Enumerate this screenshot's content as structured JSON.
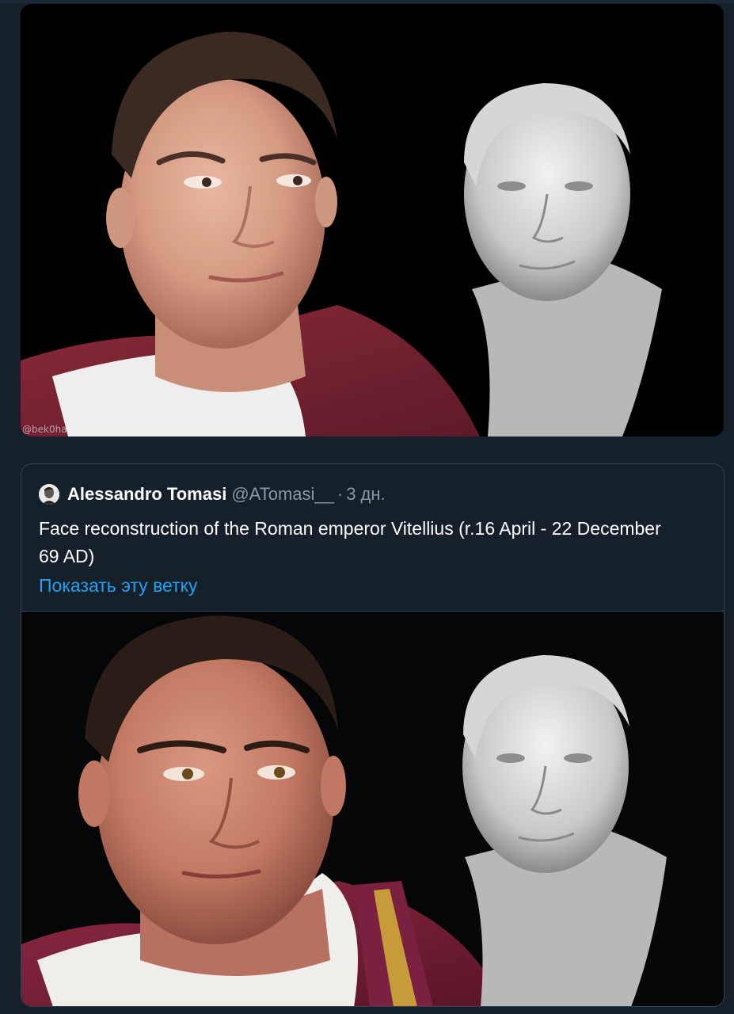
{
  "top_media": {
    "alt": "Reconstructed face beside marble bust",
    "watermark": "@bek0ha"
  },
  "quote": {
    "author": {
      "name": "Alessandro Tomasi",
      "handle": "@ATomasi__",
      "separator": "·",
      "time": "3 дн."
    },
    "text": "Face reconstruction of the Roman emperor Vitellius (r.16 April - 22 December 69 AD)",
    "show_thread": "Показать эту ветку"
  },
  "colors": {
    "background": "#15202b",
    "card_border": "#38444d",
    "link": "#1da1f2",
    "muted": "#8899a6"
  }
}
